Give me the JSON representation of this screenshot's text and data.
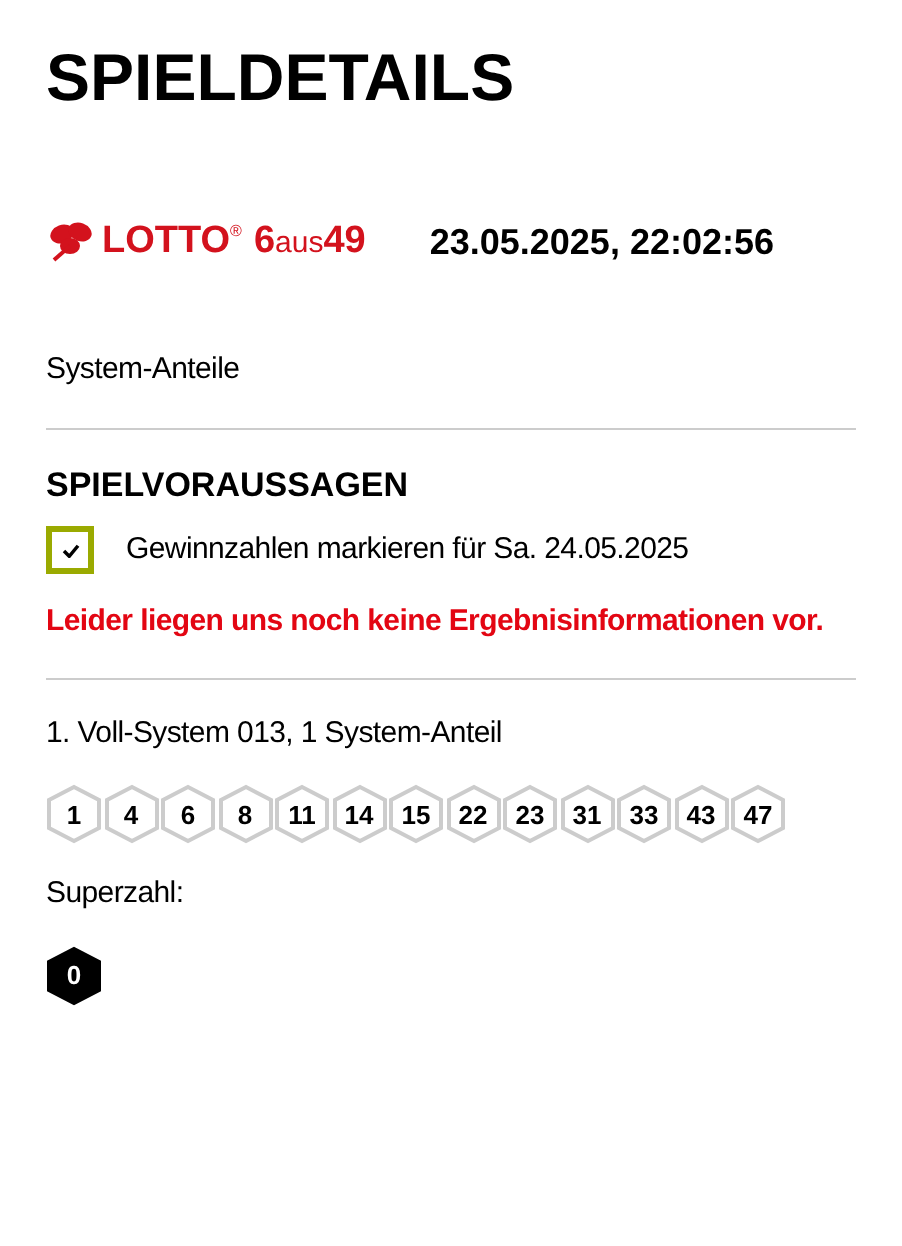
{
  "title": "SPIELDETAILS",
  "logo": {
    "brand": "LOTTO",
    "mark": "®",
    "game_a": "6",
    "game_word": "aus",
    "game_b": "49"
  },
  "datetime": "23.05.2025, 22:02:56",
  "ticket_type": "System-Anteile",
  "section": {
    "heading": "SPIELVORAUSSAGEN",
    "checkbox": {
      "label": "Gewinnzahlen markieren für Sa. 24.05.2025",
      "checked": true
    },
    "notice": "Leider liegen uns noch keine Ergebnisinformationen vor."
  },
  "game": {
    "label": "1. Voll-System 013, 1 System-Anteil",
    "numbers": [
      "1",
      "4",
      "6",
      "8",
      "11",
      "14",
      "15",
      "22",
      "23",
      "31",
      "33",
      "43",
      "47"
    ],
    "superzahl_label": "Superzahl:",
    "superzahl": "0"
  }
}
